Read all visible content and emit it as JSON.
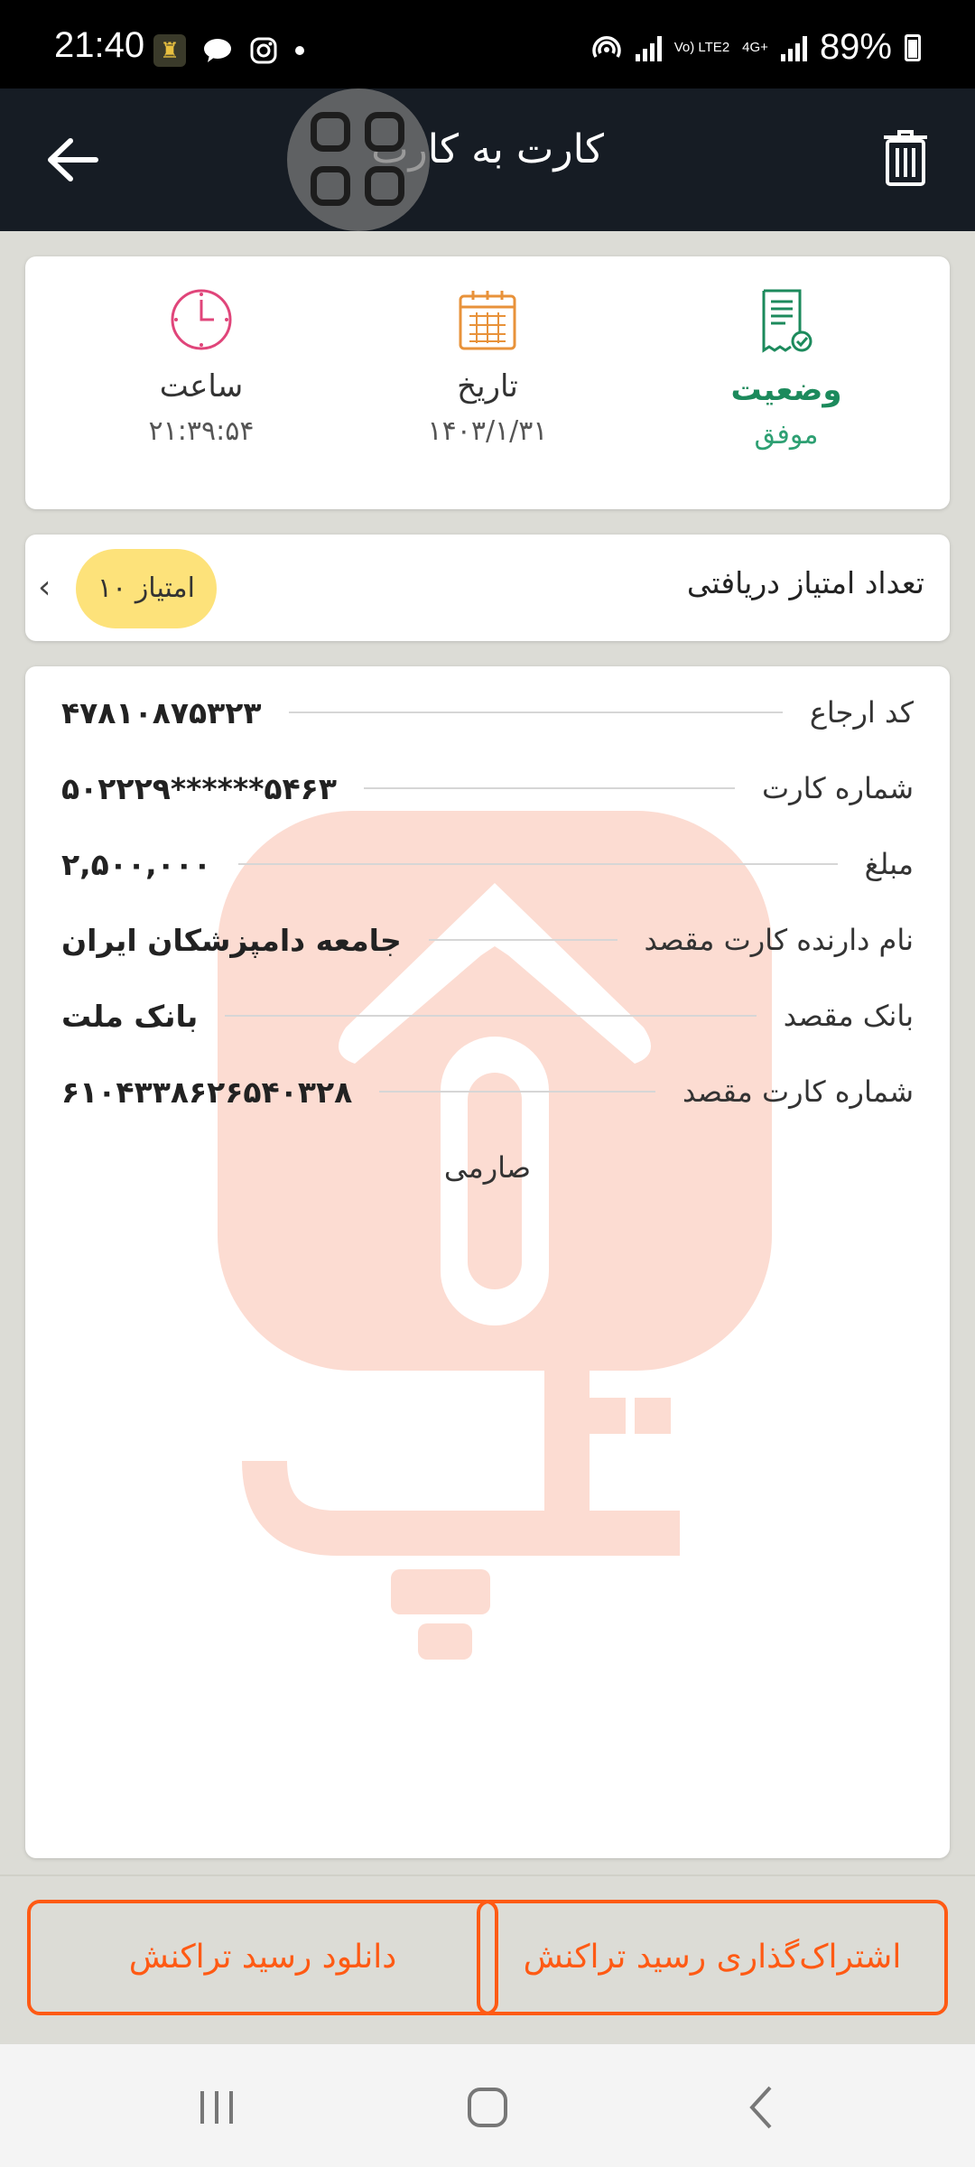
{
  "status_bar": {
    "time": "21:40",
    "network": "Vo) LTE2",
    "network_gen": "4G+",
    "battery": "89%"
  },
  "header": {
    "title": "کارت به کارت",
    "icons": [
      "back-arrow-icon",
      "trash-icon",
      "floating-grid-icon"
    ]
  },
  "summary": {
    "status_label": "وضعیت",
    "status_value": "موفق",
    "date_label": "تاریخ",
    "date_value": "۱۴۰۳/۱/۳۱",
    "time_label": "ساعت",
    "time_value": "۲۱:۳۹:۵۴"
  },
  "points": {
    "label": "تعداد امتیاز دریافتی",
    "badge": "۱۰ امتیاز"
  },
  "details": {
    "rows": [
      {
        "key": "کد ارجاع",
        "value": "۴۷۸۱۰۸۷۵۳۲۳"
      },
      {
        "key": "شماره کارت",
        "value": "۵۰۲۲۲۹******۵۴۶۳"
      },
      {
        "key": "مبلغ",
        "value": "۲,۵۰۰,۰۰۰"
      },
      {
        "key": "نام دارنده کارت مقصد",
        "value": "جامعه دامپزشکان ایران"
      },
      {
        "key": "بانک مقصد",
        "value": "بانک ملت"
      },
      {
        "key": "شماره کارت مقصد",
        "value": "۶۱۰۴۳۳۸۶۲۶۵۴۰۳۲۸"
      }
    ],
    "note": "صارمی"
  },
  "actions": {
    "share": "اشتراک‌گذاری رسید تراکنش",
    "download": "دانلود رسید تراکنش"
  },
  "colors": {
    "header_bg": "#161c24",
    "accent_orange": "#ff5a14",
    "status_green": "#1c8a5c",
    "badge_yellow": "#fde27a",
    "watermark": "#fcdcd2"
  }
}
